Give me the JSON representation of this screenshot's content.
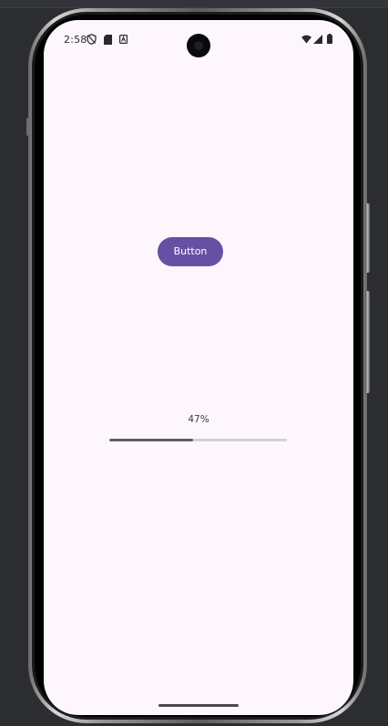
{
  "status_bar": {
    "time": "2:58",
    "left_icons": [
      "vpn-shield-icon",
      "sd-card-icon",
      "notification-a-icon"
    ],
    "right_icons": [
      "wifi-icon",
      "cell-signal-icon",
      "battery-icon"
    ]
  },
  "main": {
    "button_label": "Button",
    "progress": {
      "label": "47%",
      "value": 0.47
    }
  },
  "colors": {
    "screen_background": "#fdf7fd",
    "button_background": "#6750a4",
    "button_text": "#ffffff",
    "progress_fill": "#635a6a",
    "progress_track": "#d6d0d8"
  }
}
